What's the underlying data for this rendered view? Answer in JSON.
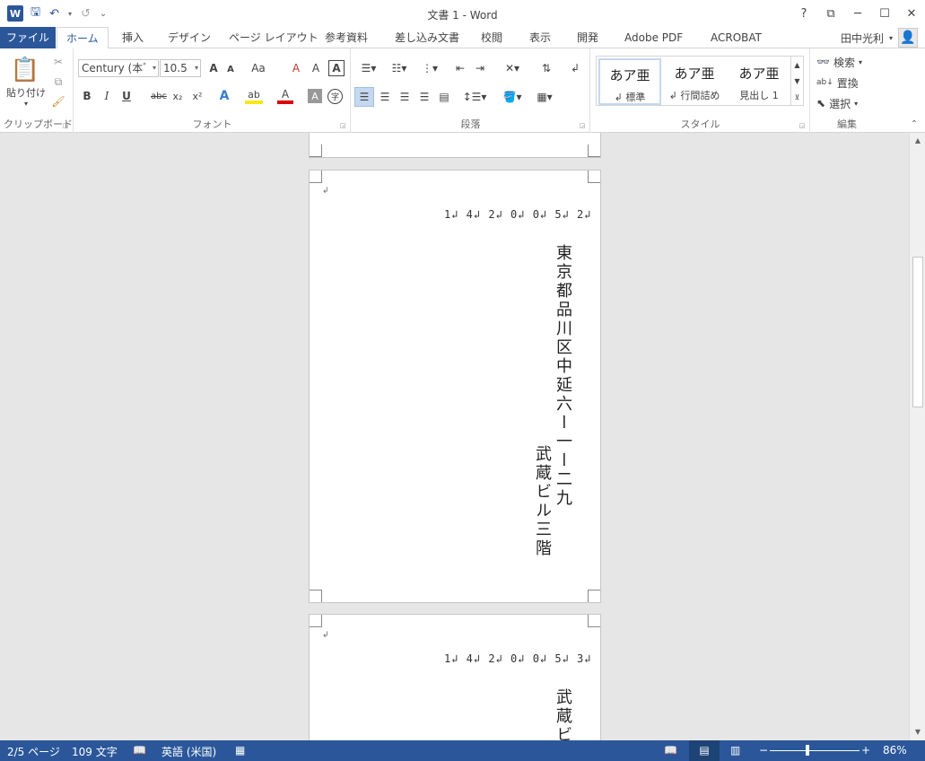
{
  "window": {
    "title": "文書 1 - Word"
  },
  "qat": {
    "undo": "↶",
    "redo": "↺",
    "customize": "⌄"
  },
  "tabs": [
    {
      "label": "ファイル"
    },
    {
      "label": "ホーム"
    },
    {
      "label": "挿入"
    },
    {
      "label": "デザイン"
    },
    {
      "label": "ページ レイアウト"
    },
    {
      "label": "参考資料"
    },
    {
      "label": "差し込み文書"
    },
    {
      "label": "校閲"
    },
    {
      "label": "表示"
    },
    {
      "label": "開発"
    },
    {
      "label": "Adobe PDF"
    },
    {
      "label": "ACROBAT"
    }
  ],
  "user": {
    "name": "田中光利"
  },
  "ribbon": {
    "clipboard": {
      "label": "クリップボード",
      "paste": "貼り付け"
    },
    "font": {
      "label": "フォント",
      "font_name": "Century (本ﾞ",
      "font_size": "10.5",
      "grow": "A",
      "shrink": "A",
      "case": "Aa",
      "clear": "A",
      "phonetic": "A",
      "border_char": "A",
      "bold": "B",
      "italic": "I",
      "underline": "U",
      "strike": "abc",
      "sub": "x₂",
      "sup": "x²",
      "effect": "A",
      "highlight": "ab",
      "color": "A",
      "shade": "A",
      "enclose": "字"
    },
    "paragraph": {
      "label": "段落"
    },
    "styles": {
      "label": "スタイル",
      "items": [
        {
          "sample": "あア亜",
          "name": "↲ 標準"
        },
        {
          "sample": "あア亜",
          "name": "↲ 行間詰め"
        },
        {
          "sample": "あア亜",
          "name": "見出し 1"
        }
      ]
    },
    "editing": {
      "label": "編集",
      "find": "検索",
      "replace": "置換",
      "select": "選択"
    }
  },
  "document": {
    "page2": {
      "postal": "1↲ 4↲ 2↲ 0↲ 0↲ 5↲ 2↲",
      "address_line1": "東京都品川区中延六ー一ー二九",
      "address_line2": "武蔵ビル三階"
    },
    "page3": {
      "postal": "1↲ 4↲ 2↲ 0↲ 0↲ 5↲ 3↲",
      "address_line1": "武蔵ビ"
    }
  },
  "status": {
    "page": "2/5 ページ",
    "words": "109 文字",
    "language": "英語 (米国)",
    "zoom": "86%"
  },
  "colors": {
    "accent": "#2b579a"
  }
}
